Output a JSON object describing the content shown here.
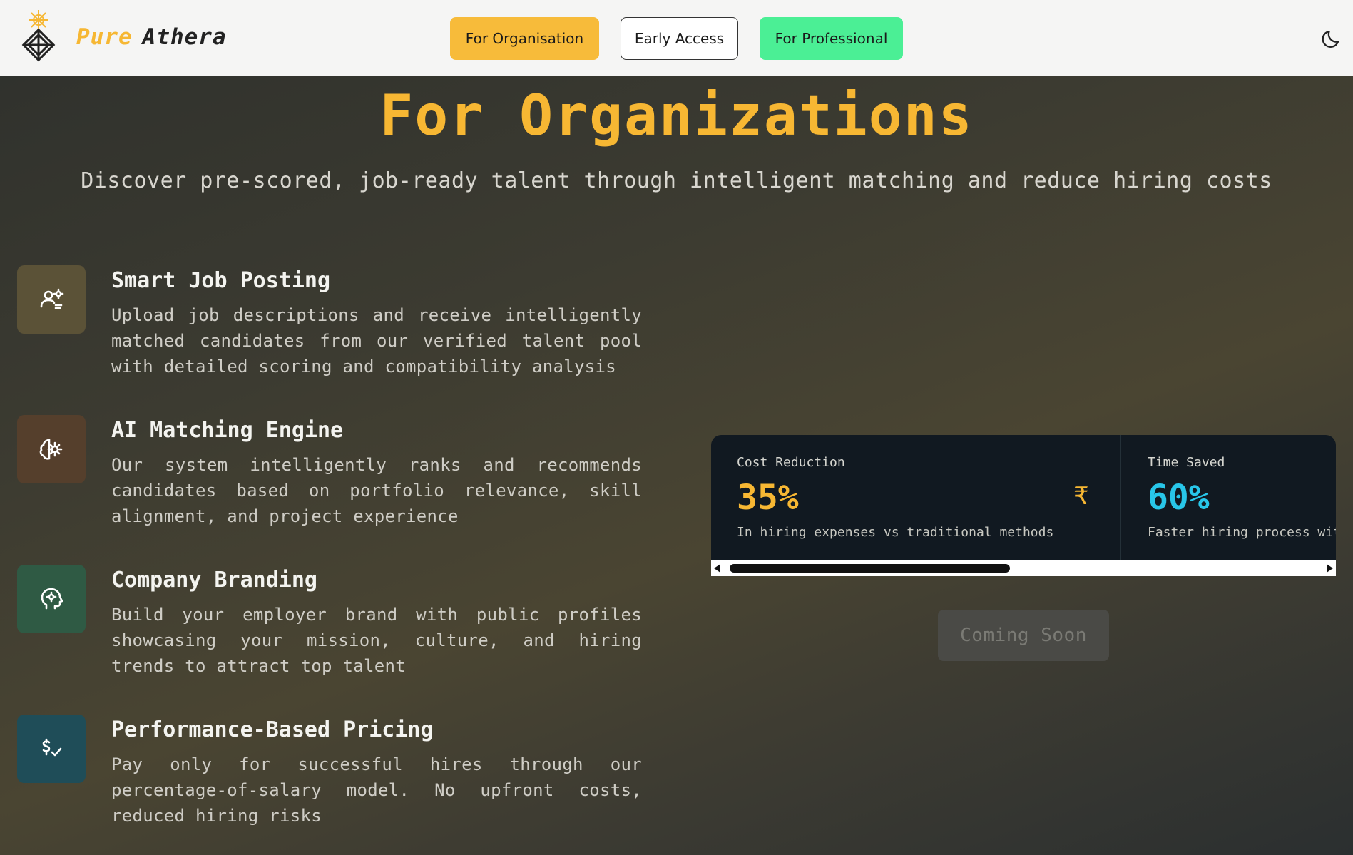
{
  "header": {
    "brand_part1": "Pure",
    "brand_part2": "Athera",
    "nav": {
      "organisation": "For Organisation",
      "early_access": "Early Access",
      "professional": "For Professional"
    },
    "theme_toggle_icon": "moon-icon"
  },
  "hero": {
    "title": "For Organizations",
    "subtitle": "Discover pre-scored, job-ready talent through intelligent matching and reduce hiring costs"
  },
  "features": [
    {
      "icon": "user-cog-icon",
      "title": "Smart Job Posting",
      "description": "Upload job descriptions and receive intelligently matched candidates from our verified talent pool with detailed scoring and compatibility analysis"
    },
    {
      "icon": "brain-cog-icon",
      "title": "AI Matching Engine",
      "description": "Our system intelligently ranks and recommends candidates based on portfolio relevance, skill alignment, and project experience"
    },
    {
      "icon": "head-gear-icon",
      "title": "Company Branding",
      "description": "Build your employer brand with public profiles showcasing your mission, culture, and hiring trends to attract top talent"
    },
    {
      "icon": "dollar-check-icon",
      "title": "Performance-Based Pricing",
      "description": "Pay only for successful hires through our percentage-of-salary model. No upfront costs, reduced hiring risks"
    }
  ],
  "stats": [
    {
      "label": "Cost Reduction",
      "value": "35%",
      "note": "In hiring expenses vs traditional methods",
      "icon": "rupee-icon",
      "icon_text": "₹"
    },
    {
      "label": "Time Saved",
      "value": "60%",
      "note": "Faster hiring process wit"
    }
  ],
  "coming_soon": "Coming Soon",
  "colors": {
    "accent_yellow": "#f7b733",
    "accent_green": "#4bef95",
    "accent_cyan": "#28c6e9"
  }
}
